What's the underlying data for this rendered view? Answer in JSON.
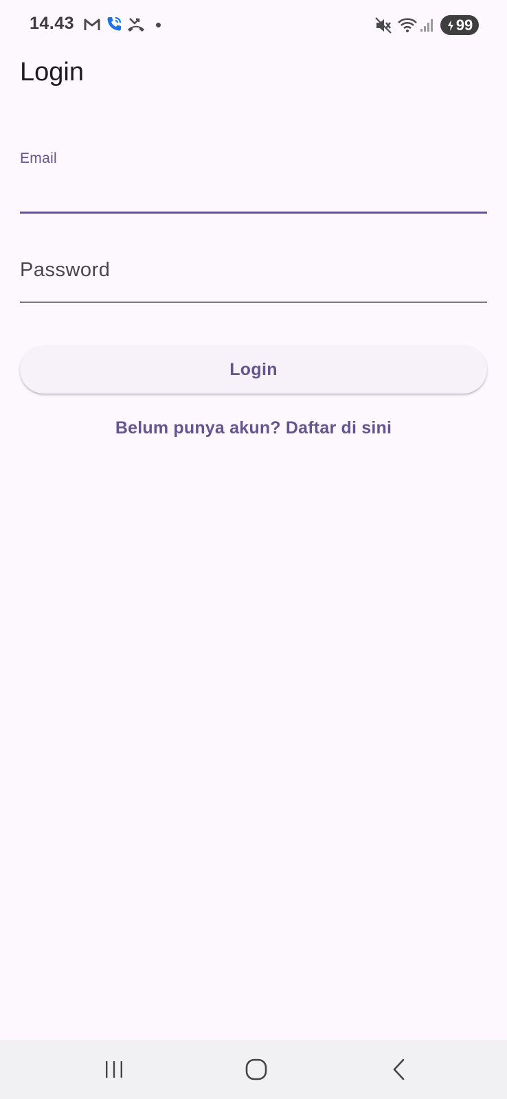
{
  "status_bar": {
    "time": "14.43",
    "battery_level": "99",
    "icons": [
      "gmail-icon",
      "phone-call-icon",
      "missed-call-icon",
      "notification-dot-icon",
      "mute-icon",
      "wifi-icon",
      "signal-icon",
      "battery-charging-icon"
    ]
  },
  "header": {
    "title": "Login"
  },
  "form": {
    "email_label": "Email",
    "email_value": "",
    "password_placeholder": "Password",
    "password_value": "",
    "login_button_label": "Login",
    "register_link_text": "Belum punya akun? Daftar di sini"
  },
  "nav_bar": {
    "items": [
      "recent-apps-icon",
      "home-icon",
      "back-icon"
    ]
  },
  "colors": {
    "background": "#fdf7fe",
    "accent": "#65558f",
    "text": "#1d1b20",
    "button_bg": "#f7f2fa",
    "nav_bg": "#f1f1f3"
  }
}
